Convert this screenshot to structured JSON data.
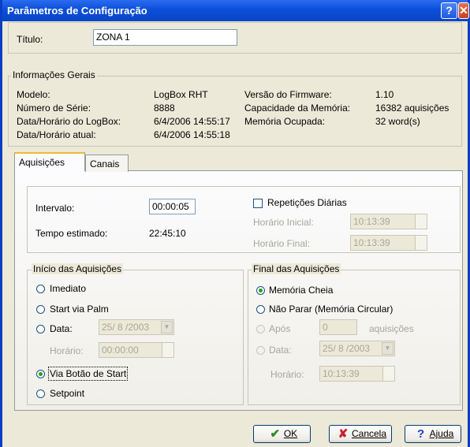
{
  "window": {
    "title": "Parâmetros de Configuração"
  },
  "titulo": {
    "label": "Título:",
    "value": "ZONA 1"
  },
  "info": {
    "legend": "Informações Gerais",
    "modelo_label": "Modelo:",
    "modelo_value": "LogBox RHT",
    "serie_label": "Número de Série:",
    "serie_value": "8888",
    "data_logbox_label": "Data/Horário do LogBox:",
    "data_logbox_value": "6/4/2006 14:55:17",
    "data_atual_label": "Data/Horário atual:",
    "data_atual_value": "6/4/2006 14:55:18",
    "firmware_label": "Versão do Firmware:",
    "firmware_value": "1.10",
    "capacidade_label": "Capacidade da Memória:",
    "capacidade_value": "16382 aquisições",
    "ocupada_label": "Memória Ocupada:",
    "ocupada_value": "32 word(s)"
  },
  "tabs": [
    {
      "label": "Aquisições"
    },
    {
      "label": "Canais"
    }
  ],
  "aquisicoes": {
    "intervalo_label": "Intervalo:",
    "intervalo_value": "00:00:05",
    "tempo_label": "Tempo estimado:",
    "tempo_value": "22:45:10",
    "repeticoes_label": "Repetições Diárias",
    "horario_inicial_label": "Horário Inicial:",
    "horario_inicial_value": "10:13:39",
    "horario_final_label": "Horário Final:",
    "horario_final_value": "10:13:39"
  },
  "inicio": {
    "legend": "Início das Aquisições",
    "imediato": "Imediato",
    "start_palm": "Start via Palm",
    "data_label": "Data:",
    "data_value": "25/ 8 /2003",
    "horario_label": "Horário:",
    "horario_value": "00:00:00",
    "via_botao": "Via Botão de Start",
    "setpoint": "Setpoint"
  },
  "final": {
    "legend": "Final das Aquisições",
    "memoria_cheia": "Memória Cheia",
    "nao_parar": "Não Parar (Memória Circular)",
    "apos_label": "Após",
    "apos_value": "0",
    "aquisicoes_suffix": "aquisições",
    "data_label": "Data:",
    "data_value": "25/ 8 /2003",
    "horario_label": "Horário:",
    "horario_value": "10:13:39"
  },
  "buttons": {
    "ok": "OK",
    "cancel": "Cancela",
    "help": "Ajuda"
  }
}
